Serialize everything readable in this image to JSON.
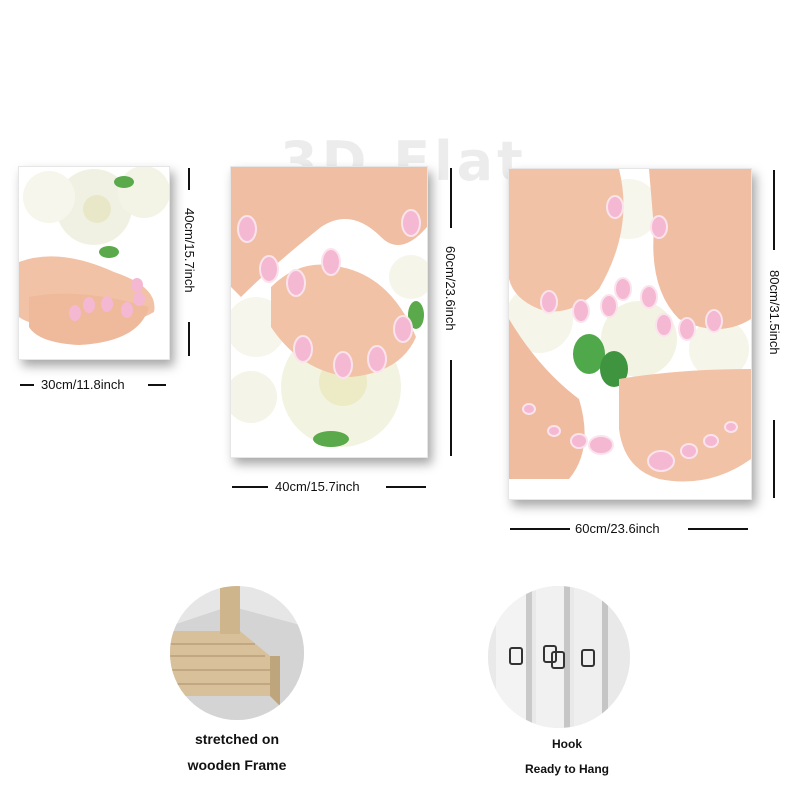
{
  "watermark": "3D Flat",
  "panels": {
    "small": {
      "width_label": "30cm/11.8inch",
      "height_label": "40cm/15.7inch"
    },
    "medium": {
      "width_label": "40cm/15.7inch",
      "height_label": "60cm/23.6inch"
    },
    "large": {
      "width_label": "60cm/23.6inch",
      "height_label": "80cm/31.5inch"
    }
  },
  "features": {
    "frame": {
      "line1": "stretched on",
      "line2": "wooden Frame"
    },
    "hook": {
      "line1": "Hook",
      "line2": "Ready to Hang"
    }
  },
  "colors": {
    "nail_pink": "#f5b8d2",
    "skin": "#f4c3a8",
    "rose_white": "#f4f4e8",
    "leaf_green": "#4fa84a"
  }
}
